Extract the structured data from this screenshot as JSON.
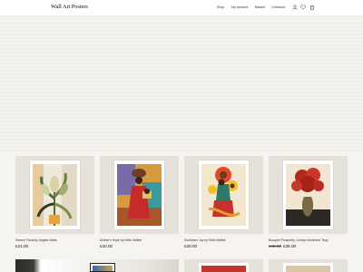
{
  "header": {
    "logo": "Wall Art Posters",
    "nav": [
      {
        "label": "Shop"
      },
      {
        "label": "My account"
      },
      {
        "label": "Basket"
      },
      {
        "label": "Checkout"
      }
    ],
    "icons": [
      "user-icon",
      "heart-icon",
      "cart-icon"
    ]
  },
  "products": [
    {
      "title": "Serene Floral by Angela Marts",
      "price": "£24.00"
    },
    {
      "title": "Mother's Hope by Keith Mallett",
      "price": "£30.00"
    },
    {
      "title": "Sunflower Joy by Keith Mallett",
      "price": "£30.00"
    },
    {
      "title": "Bouquet Prosperity, Jocelyn Anderson Tepp",
      "old_price": "£45.00",
      "price": "£35.00"
    }
  ],
  "colors": {
    "background": "#f6f4ef",
    "card_bg": "#e6e2da",
    "text": "#222222"
  }
}
